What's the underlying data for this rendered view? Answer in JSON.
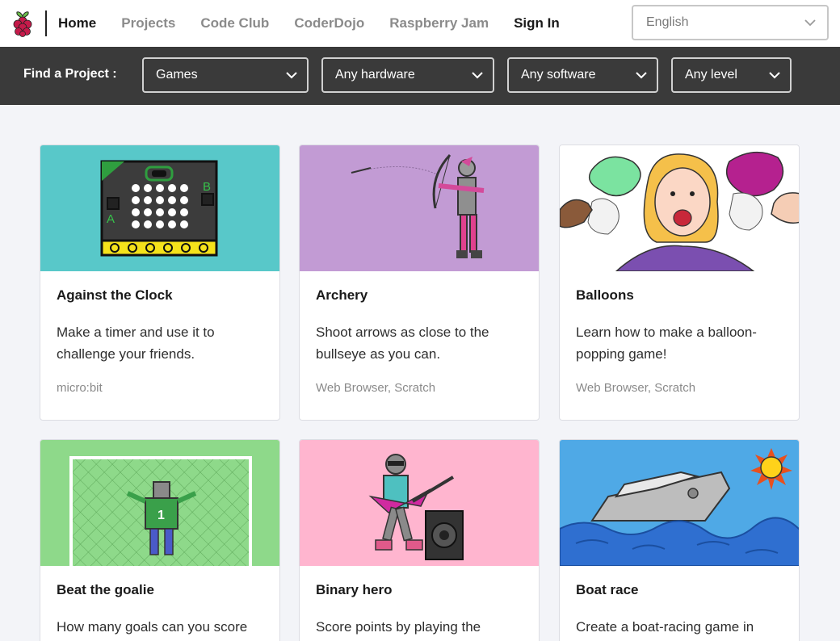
{
  "nav": {
    "links": [
      {
        "label": "Home",
        "active": true
      },
      {
        "label": "Projects"
      },
      {
        "label": "Code Club"
      },
      {
        "label": "CoderDojo"
      },
      {
        "label": "Raspberry Jam"
      },
      {
        "label": "Sign In"
      }
    ],
    "language": "English"
  },
  "filters": {
    "label": "Find a Project :",
    "category": "Games",
    "hardware": "Any hardware",
    "software": "Any software",
    "level": "Any level"
  },
  "colors": {
    "thumb_against_the_clock": "#58c8c9",
    "thumb_archery": "#c29bd4",
    "thumb_balloons": "#ffffff",
    "thumb_beat_the_goalie": "#8ed98a",
    "thumb_binary_hero": "#ffb5cf",
    "thumb_boat_race": "#4fa9e6"
  },
  "projects": [
    {
      "title": "Against the Clock",
      "description": "Make a timer and use it to challenge your friends.",
      "tags": "micro:bit"
    },
    {
      "title": "Archery",
      "description": "Shoot arrows as close to the bullseye as you can.",
      "tags": "Web Browser, Scratch"
    },
    {
      "title": "Balloons",
      "description": "Learn how to make a balloon-popping game!",
      "tags": "Web Browser, Scratch"
    },
    {
      "title": "Beat the goalie",
      "description": "How many goals can you score",
      "tags": ""
    },
    {
      "title": "Binary hero",
      "description": "Score points by playing the",
      "tags": ""
    },
    {
      "title": "Boat race",
      "description": "Create a boat-racing game in",
      "tags": ""
    }
  ]
}
